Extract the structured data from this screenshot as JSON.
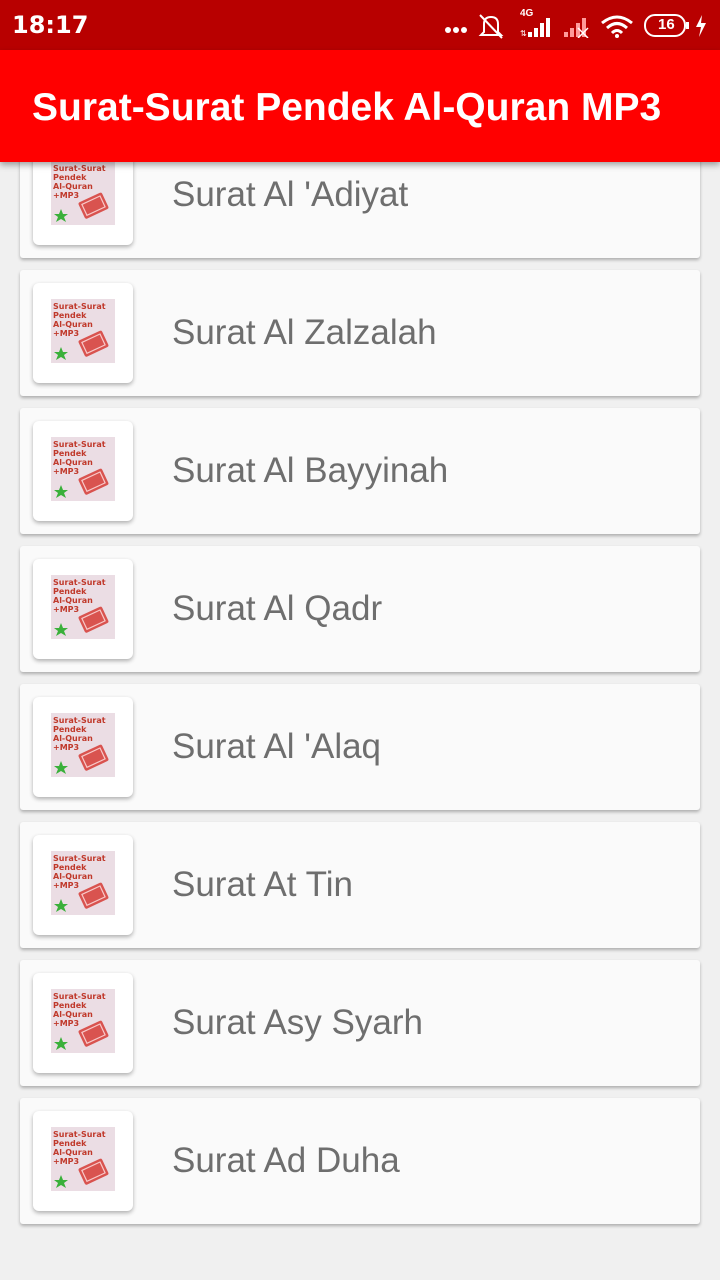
{
  "status_bar": {
    "time": "18:17",
    "network": "4G",
    "battery": "16",
    "icons": [
      "dots-icon",
      "mute-bell-icon",
      "signal-icon",
      "signal-empty-icon",
      "wifi-icon",
      "battery-icon",
      "charging-icon"
    ]
  },
  "app_bar": {
    "title": "Surat-Surat Pendek Al-Quran MP3",
    "color": "#ff0000"
  },
  "thumbnail": {
    "text": "Surat-Surat Pendek Al-Quran +MP3"
  },
  "list": {
    "items": [
      {
        "label": "Surat Al 'Adiyat"
      },
      {
        "label": "Surat Al Zalzalah"
      },
      {
        "label": "Surat Al Bayyinah"
      },
      {
        "label": "Surat Al Qadr"
      },
      {
        "label": "Surat Al 'Alaq"
      },
      {
        "label": "Surat At Tin"
      },
      {
        "label": "Surat Asy Syarh"
      },
      {
        "label": "Surat Ad Duha"
      }
    ]
  }
}
